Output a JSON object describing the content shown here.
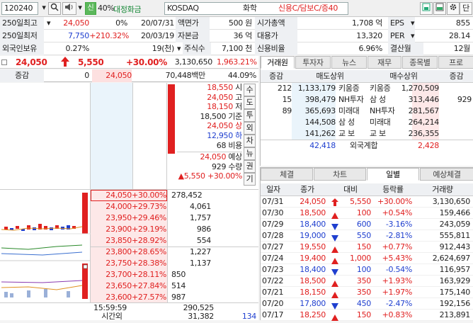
{
  "header": {
    "code": "120240",
    "percent": "40%",
    "stock_name": "대정화금",
    "market": "KOSDAQ",
    "sector": "화학",
    "credit": "신용C/담보C/증40",
    "sin_badge": "신",
    "search_icon": "search-icon",
    "speaker_icon": "speaker-icon",
    "gear_icon": "gear-icon",
    "dan": "단"
  },
  "info": {
    "r1": {
      "l1": "250일최고",
      "v1": "24,050",
      "p1": "0%",
      "d1": "20/07/31",
      "l2": "액면가",
      "v2": "500 원",
      "l3": "시가총액",
      "v3": "1,708 억",
      "l4": "EPS",
      "v4": "855"
    },
    "r2": {
      "l1": "250일최저",
      "v1": "7,750",
      "p1": "+210.32%",
      "d1": "20/03/19",
      "l2": "자본금",
      "v2": "36 억",
      "l3": "대용가",
      "v3": "13,320",
      "l4": "PER",
      "v4": "28.14"
    },
    "r3": {
      "l1": "외국인보유",
      "v1": "0.27%",
      "p1": "19(천)",
      "l2": "주식수",
      "v2": "7,100 천",
      "l3": "신용비율",
      "v3": "6.96%",
      "l4": "결산월",
      "v4": "12월"
    }
  },
  "price": {
    "current": "24,050",
    "change": "5,550",
    "rate": "+30.00%",
    "volume": "3,130,650",
    "vol_rate": "1,963.21%",
    "zk_label": "증감",
    "zk_val": "0",
    "prev": "24,050",
    "amount": "70,448백만",
    "ratio": "44.09%"
  },
  "summary": [
    {
      "v": "18,550",
      "l": "시"
    },
    {
      "v": "24,050",
      "l": "고"
    },
    {
      "v": "18,150",
      "l": "저"
    },
    {
      "v": "18,500",
      "l": "기준"
    },
    {
      "v": "24,050",
      "l": "상"
    },
    {
      "v": "12,950",
      "l": "하"
    },
    {
      "v": "68",
      "l": "비용"
    },
    {
      "v": "24,050",
      "l": "예상"
    },
    {
      "v": "929",
      "l": "수량"
    },
    {
      "v": "5,550",
      "l": "+30.00%"
    }
  ],
  "side_buttons": [
    "수",
    "도",
    "투",
    "외",
    "차",
    "뉴",
    "권",
    "기"
  ],
  "orderbook": [
    {
      "price": "24,050",
      "rate": "+30.00%",
      "qty": "278,452"
    },
    {
      "price": "24,000",
      "rate": "+29.73%",
      "qty": "4,061"
    },
    {
      "price": "23,950",
      "rate": "+29.46%",
      "qty": "1,757"
    },
    {
      "price": "23,900",
      "rate": "+29.19%",
      "qty": "986"
    },
    {
      "price": "23,850",
      "rate": "+28.92%",
      "qty": "554"
    },
    {
      "price": "23,800",
      "rate": "+28.65%",
      "qty": "1,227"
    },
    {
      "price": "23,750",
      "rate": "+28.38%",
      "qty": "1,137"
    },
    {
      "price": "23,700",
      "rate": "+28.11%",
      "qty": "850"
    },
    {
      "price": "23,650",
      "rate": "+27.84%",
      "qty": "514"
    },
    {
      "price": "23,600",
      "rate": "+27.57%",
      "qty": "987"
    }
  ],
  "bottom": {
    "time": "15:59:59",
    "total": "290,525",
    "time_label": "시간외",
    "after": "31,382",
    "after2": "134"
  },
  "broker": {
    "tabs": [
      "거래원",
      "투자자",
      "뉴스",
      "재무",
      "종목별",
      "프로"
    ],
    "headers": [
      "증감",
      "매도상위",
      "매수상위",
      "증감"
    ],
    "rows": [
      {
        "z1": "212",
        "sv": "1,133,179",
        "sn": "키움증",
        "bn": "키움증",
        "bv": "1,270,509",
        "z2": ""
      },
      {
        "z1": "15",
        "sv": "398,479",
        "sn": "NH투자",
        "bn": "삼  성",
        "bv": "313,446",
        "z2": "929"
      },
      {
        "z1": "89",
        "sv": "365,693",
        "sn": "미래대",
        "bn": "NH투자",
        "bv": "281,567",
        "z2": ""
      },
      {
        "z1": "",
        "sv": "144,508",
        "sn": "삼  성",
        "bn": "미래대",
        "bv": "264,214",
        "z2": ""
      },
      {
        "z1": "",
        "sv": "141,262",
        "sn": "교  보",
        "bn": "교  보",
        "bv": "236,355",
        "z2": ""
      }
    ],
    "foreign": {
      "sv": "42,418",
      "label": "외국계합",
      "bv": "2,428"
    }
  },
  "daily": {
    "tabs": [
      "체결",
      "차트",
      "일별",
      "예상체결"
    ],
    "headers": [
      "일자",
      "종가",
      "대비",
      "등락률",
      "거래량"
    ],
    "rows": [
      {
        "d": "07/31",
        "c": "24,050",
        "dir": "limit",
        "ch": "5,550",
        "r": "+30.00%",
        "v": "3,130,650"
      },
      {
        "d": "07/30",
        "c": "18,500",
        "dir": "up",
        "ch": "100",
        "r": "+0.54%",
        "v": "159,466"
      },
      {
        "d": "07/29",
        "c": "18,400",
        "dir": "down",
        "ch": "600",
        "r": "-3.16%",
        "v": "243,059"
      },
      {
        "d": "07/28",
        "c": "19,000",
        "dir": "down",
        "ch": "550",
        "r": "-2.81%",
        "v": "555,811"
      },
      {
        "d": "07/27",
        "c": "19,550",
        "dir": "up",
        "ch": "150",
        "r": "+0.77%",
        "v": "912,443"
      },
      {
        "d": "07/24",
        "c": "19,400",
        "dir": "up",
        "ch": "1,000",
        "r": "+5.43%",
        "v": "2,624,697"
      },
      {
        "d": "07/23",
        "c": "18,400",
        "dir": "down",
        "ch": "100",
        "r": "-0.54%",
        "v": "116,957"
      },
      {
        "d": "07/22",
        "c": "18,500",
        "dir": "up",
        "ch": "350",
        "r": "+1.93%",
        "v": "163,929"
      },
      {
        "d": "07/21",
        "c": "18,150",
        "dir": "up",
        "ch": "350",
        "r": "+1.97%",
        "v": "175,140"
      },
      {
        "d": "07/20",
        "c": "17,800",
        "dir": "down",
        "ch": "450",
        "r": "-2.47%",
        "v": "192,156"
      },
      {
        "d": "07/17",
        "c": "18,250",
        "dir": "up",
        "ch": "150",
        "r": "+0.83%",
        "v": "213,891"
      }
    ]
  }
}
